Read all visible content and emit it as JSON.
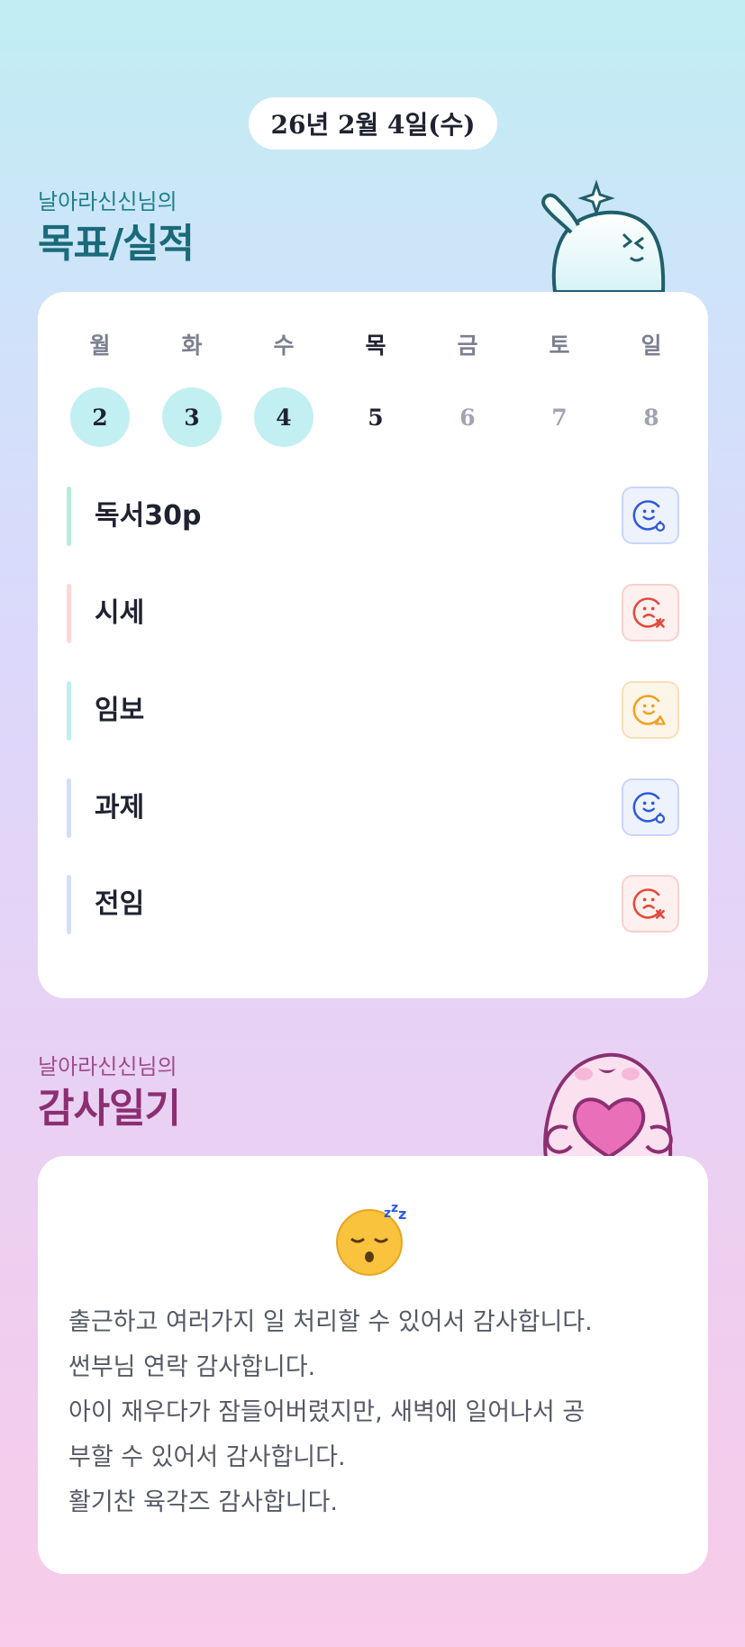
{
  "date": "26년 2월 4일(수)",
  "goals_section": {
    "subtitle": "날아라신신님의",
    "title": "목표/실적"
  },
  "week": {
    "days": [
      {
        "name": "월",
        "num": "2",
        "state": "done"
      },
      {
        "name": "화",
        "num": "3",
        "state": "done"
      },
      {
        "name": "수",
        "num": "4",
        "state": "done"
      },
      {
        "name": "목",
        "num": "5",
        "state": "today"
      },
      {
        "name": "금",
        "num": "6",
        "state": "future"
      },
      {
        "name": "토",
        "num": "7",
        "state": "future"
      },
      {
        "name": "일",
        "num": "8",
        "state": "future"
      }
    ]
  },
  "goals": [
    {
      "label": "독서30p",
      "bar_color": "#b7ecd9",
      "status": "success-icon"
    },
    {
      "label": "시세",
      "bar_color": "#ffd6d6",
      "status": "fail-icon"
    },
    {
      "label": "임보",
      "bar_color": "#bfeef0",
      "status": "partial-icon"
    },
    {
      "label": "과제",
      "bar_color": "#d3def8",
      "status": "success-icon"
    },
    {
      "label": "전임",
      "bar_color": "#d3def8",
      "status": "fail-icon"
    }
  ],
  "gratitude_section": {
    "subtitle": "날아라신신님의",
    "title": "감사일기",
    "emoji": "sleeping-face-icon",
    "lines": [
      "출근하고 여러가지 일 처리할 수 있어서 감사합니다.",
      "썬부님 연락 감사합니다.",
      "아이 재우다가 잠들어버렸지만, 새벽에 일어나서 공",
      "부할 수 있어서 감사합니다.",
      "활기찬 육각즈 감사합니다."
    ]
  },
  "colors": {
    "success": "#2f5bd9",
    "fail": "#e04b3c",
    "partial": "#f0a023",
    "done_day": "#c2eff2"
  }
}
